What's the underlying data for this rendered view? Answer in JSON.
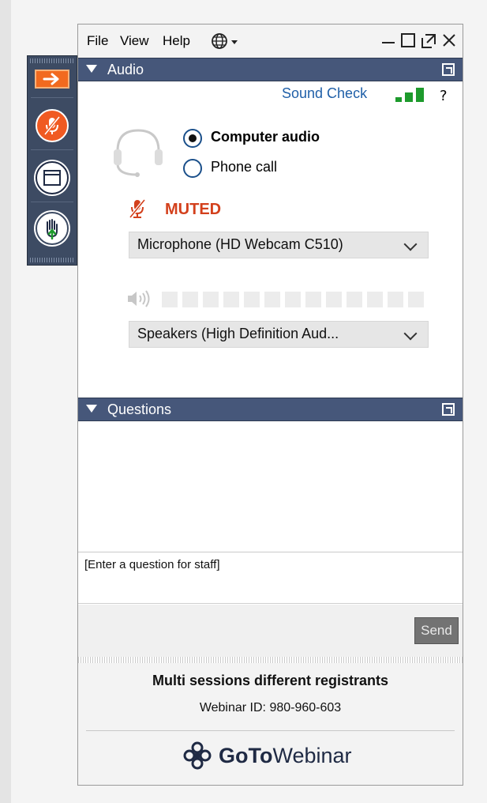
{
  "menu": {
    "file": "File",
    "view": "View",
    "help": "Help"
  },
  "audio": {
    "section_title": "Audio",
    "sound_check": "Sound Check",
    "help": "?",
    "computer_audio": "Computer audio",
    "phone_call": "Phone call",
    "selected_mode": "Computer audio",
    "muted": "MUTED",
    "microphone": "Microphone (HD Webcam C510)",
    "speakers": "Speakers (High Definition Aud..."
  },
  "questions": {
    "section_title": "Questions",
    "placeholder": "[Enter a question for staff]",
    "send": "Send"
  },
  "webinar": {
    "title": "Multi sessions different registrants",
    "id_text": "Webinar ID: 980-960-603",
    "logo_text_bold": "GoTo",
    "logo_text_regular": "Webinar"
  },
  "colors": {
    "accent_orange": "#f05a22",
    "section_bar": "#46577a",
    "muted_red": "#d3401c",
    "link_blue": "#1f5fa8",
    "signal_green": "#1d9a2c"
  }
}
